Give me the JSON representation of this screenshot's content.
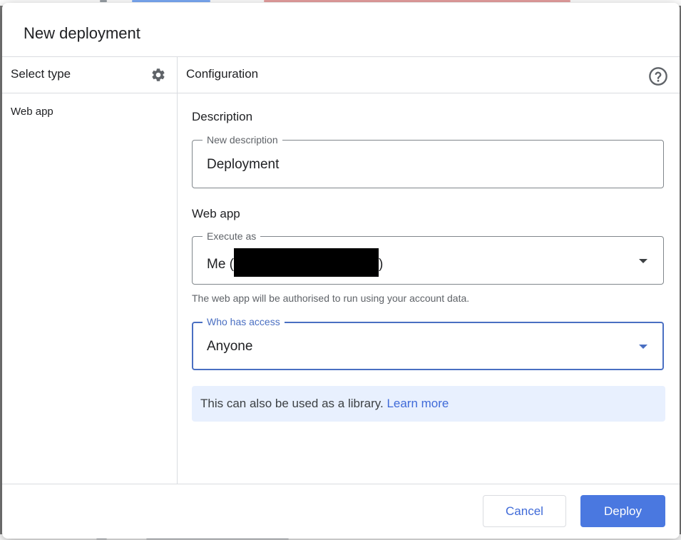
{
  "dialog": {
    "title": "New deployment"
  },
  "left_panel": {
    "header": "Select type",
    "settings_icon": "gear-icon",
    "items": [
      {
        "label": "Web app"
      }
    ]
  },
  "right_panel": {
    "header": "Configuration",
    "help_icon": "help-icon",
    "description_section": {
      "label": "Description",
      "field_legend": "New description",
      "field_value": "Deployment"
    },
    "webapp_section": {
      "label": "Web app",
      "execute_as": {
        "legend": "Execute as",
        "value_prefix": "Me (",
        "value_suffix": ")",
        "helper": "The web app will be authorised to run using your account data."
      },
      "access": {
        "legend": "Who has access",
        "value": "Anyone"
      }
    },
    "banner": {
      "text": "This can also be used as a library.",
      "link": "Learn more"
    }
  },
  "footer": {
    "cancel_label": "Cancel",
    "deploy_label": "Deploy"
  },
  "colors": {
    "accent": "#4a78e0",
    "link": "#3f6ad8",
    "focus": "#4a6fc2",
    "banner_bg": "#e8f0fe"
  }
}
